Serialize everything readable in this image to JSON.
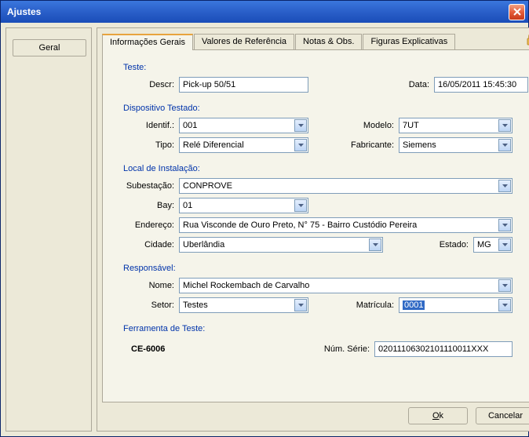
{
  "window": {
    "title": "Ajustes"
  },
  "sidebar": {
    "geral": "Geral"
  },
  "tabs": {
    "t0": "Informações Gerais",
    "t1": "Valores de Referência",
    "t2": "Notas & Obs.",
    "t3": "Figuras Explicativas"
  },
  "teste": {
    "section": "Teste:",
    "descr_lbl": "Descr:",
    "descr_val": "Pick-up 50/51",
    "data_lbl": "Data:",
    "data_val": "16/05/2011 15:45:30"
  },
  "disp": {
    "section": "Dispositivo Testado:",
    "identif_lbl": "Identif.:",
    "identif_val": "001",
    "modelo_lbl": "Modelo:",
    "modelo_val": "7UT",
    "tipo_lbl": "Tipo:",
    "tipo_val": "Relé Diferencial",
    "fabricante_lbl": "Fabricante:",
    "fabricante_val": "Siemens"
  },
  "local": {
    "section": "Local de Instalação:",
    "subestacao_lbl": "Subestação:",
    "subestacao_val": "CONPROVE",
    "bay_lbl": "Bay:",
    "bay_val": "01",
    "endereco_lbl": "Endereço:",
    "endereco_val": "Rua Visconde de Ouro Preto, N° 75 - Bairro Custódio Pereira",
    "cidade_lbl": "Cidade:",
    "cidade_val": "Uberlândia",
    "estado_lbl": "Estado:",
    "estado_val": "MG"
  },
  "resp": {
    "section": "Responsável:",
    "nome_lbl": "Nome:",
    "nome_val": "Michel Rockembach de Carvalho",
    "setor_lbl": "Setor:",
    "setor_val": "Testes",
    "matricula_lbl": "Matrícula:",
    "matricula_val": "0001"
  },
  "ferr": {
    "section": "Ferramenta de Teste:",
    "model": "CE-6006",
    "serie_lbl": "Núm. Série:",
    "serie_val": "02011106302101110011XXX"
  },
  "buttons": {
    "ok": "Ok",
    "cancel": "Cancelar"
  }
}
